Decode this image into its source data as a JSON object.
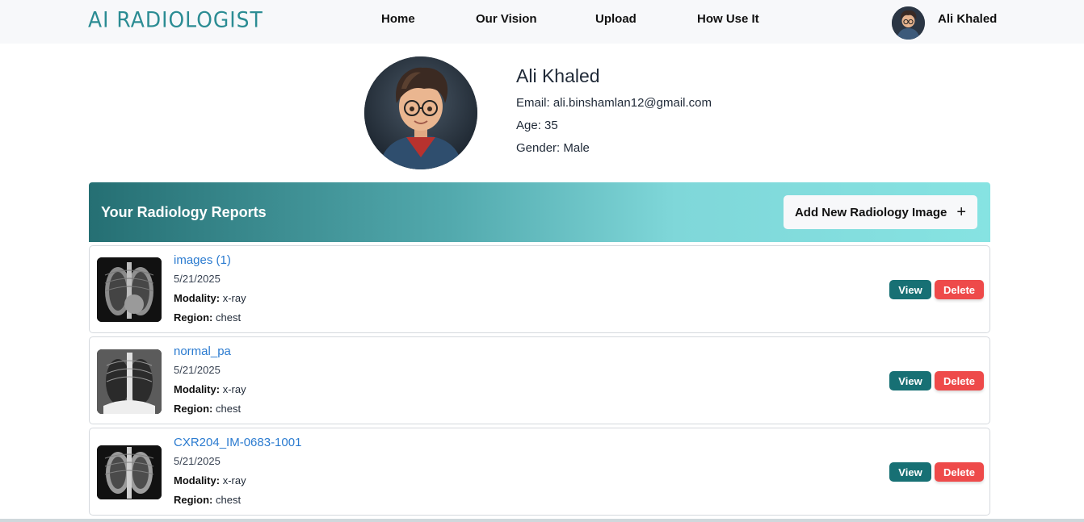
{
  "navbar": {
    "logo": "AI RADIOLOGIST",
    "links": [
      "Home",
      "Our Vision",
      "Upload",
      "How Use It"
    ],
    "user_name": "Ali Khaled"
  },
  "profile": {
    "name": "Ali Khaled",
    "email": "Email: ali.binshamlan12@gmail.com",
    "age": "Age: 35",
    "gender": "Gender: Male"
  },
  "reports": {
    "title": "Your Radiology Reports",
    "add_button": "Add New Radiology Image",
    "modality_label": "Modality:",
    "region_label": "Region:",
    "view_label": "View",
    "delete_label": "Delete",
    "items": [
      {
        "title": "images (1)",
        "date": "5/21/2025",
        "modality": "x-ray",
        "region": "chest"
      },
      {
        "title": "normal_pa",
        "date": "5/21/2025",
        "modality": "x-ray",
        "region": "chest"
      },
      {
        "title": "CXR204_IM-0683-1001",
        "date": "5/21/2025",
        "modality": "x-ray",
        "region": "chest"
      }
    ]
  },
  "colors": {
    "brand": "#2b8c93",
    "header_gradient_start": "#256f73",
    "header_gradient_end": "#86e3e2",
    "view_button": "#177074",
    "delete_button": "#ee4a4a",
    "link": "#2b7bd0"
  },
  "icons": {
    "add": "plus-icon",
    "avatar": "cartoon-boy-avatar",
    "thumbnail": "chest-xray-image"
  }
}
